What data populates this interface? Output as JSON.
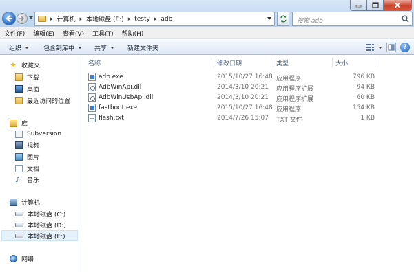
{
  "address": {
    "crumbs": [
      "计算机",
      "本地磁盘 (E:)",
      "testy",
      "adb"
    ]
  },
  "search": {
    "placeholder": "搜索 adb"
  },
  "menu": {
    "items": [
      "文件(F)",
      "编辑(E)",
      "查看(V)",
      "工具(T)",
      "帮助(H)"
    ]
  },
  "toolbar": {
    "organize": "组织",
    "include_in_library": "包含到库中",
    "share": "共享",
    "new_folder": "新建文件夹"
  },
  "sidebar": {
    "favorites": {
      "header": "收藏夹",
      "items": [
        "下载",
        "桌面",
        "最近访问的位置"
      ]
    },
    "libraries": {
      "header": "库",
      "items": [
        "Subversion",
        "视频",
        "图片",
        "文档",
        "音乐"
      ]
    },
    "computer": {
      "header": "计算机",
      "items": [
        "本地磁盘 (C:)",
        "本地磁盘 (D:)",
        "本地磁盘 (E:)"
      ],
      "selected": "本地磁盘 (E:)"
    },
    "network": {
      "header": "网络"
    }
  },
  "file_list": {
    "columns": [
      "名称",
      "修改日期",
      "类型",
      "大小"
    ],
    "rows": [
      {
        "name": "adb.exe",
        "date": "2015/10/27 16:48",
        "type": "应用程序",
        "size": "796 KB",
        "icon": "exe-icon"
      },
      {
        "name": "AdbWinApi.dll",
        "date": "2014/3/10 20:21",
        "type": "应用程序扩展",
        "size": "94 KB",
        "icon": "dll-icon"
      },
      {
        "name": "AdbWinUsbApi.dll",
        "date": "2014/3/10 20:21",
        "type": "应用程序扩展",
        "size": "60 KB",
        "icon": "dll-icon"
      },
      {
        "name": "fastboot.exe",
        "date": "2015/10/27 16:48",
        "type": "应用程序",
        "size": "154 KB",
        "icon": "exe-icon"
      },
      {
        "name": "flash.txt",
        "date": "2014/7/26 15:07",
        "type": "TXT 文件",
        "size": "1 KB",
        "icon": "txt-icon"
      }
    ]
  }
}
